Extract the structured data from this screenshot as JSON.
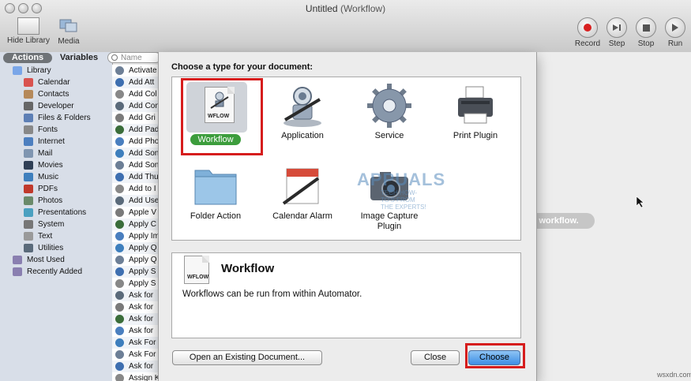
{
  "window": {
    "title": "Untitled",
    "title_suffix": "(Workflow)"
  },
  "toolbar": {
    "hide_library": "Hide Library",
    "media": "Media",
    "record": "Record",
    "step": "Step",
    "stop": "Stop",
    "run": "Run",
    "record_color": "#d82020"
  },
  "library": {
    "actions_tab": "Actions",
    "variables_tab": "Variables",
    "search_placeholder": "Name",
    "items": [
      {
        "label": "Library",
        "icon": "library-icon",
        "color": "#7aa6e8"
      },
      {
        "label": "Calendar",
        "icon": "calendar-icon",
        "color": "#d9534f"
      },
      {
        "label": "Contacts",
        "icon": "contacts-icon",
        "color": "#b5895a"
      },
      {
        "label": "Developer",
        "icon": "developer-icon",
        "color": "#666666"
      },
      {
        "label": "Files & Folders",
        "icon": "finder-icon",
        "color": "#5d7fb5"
      },
      {
        "label": "Fonts",
        "icon": "fonts-icon",
        "color": "#888888"
      },
      {
        "label": "Internet",
        "icon": "internet-icon",
        "color": "#4d7fbf"
      },
      {
        "label": "Mail",
        "icon": "mail-icon",
        "color": "#7f95b0"
      },
      {
        "label": "Movies",
        "icon": "movies-icon",
        "color": "#2f3f55"
      },
      {
        "label": "Music",
        "icon": "music-icon",
        "color": "#3e7fbd"
      },
      {
        "label": "PDFs",
        "icon": "pdf-icon",
        "color": "#c0392b"
      },
      {
        "label": "Photos",
        "icon": "photos-icon",
        "color": "#6a8a6a"
      },
      {
        "label": "Presentations",
        "icon": "presentations-icon",
        "color": "#4aa0c0"
      },
      {
        "label": "System",
        "icon": "system-icon",
        "color": "#777777"
      },
      {
        "label": "Text",
        "icon": "text-icon",
        "color": "#9a9a9a"
      },
      {
        "label": "Utilities",
        "icon": "utilities-icon",
        "color": "#5a6a7a"
      },
      {
        "label": "Most Used",
        "icon": "folder-icon",
        "color": "#8a7fb0"
      },
      {
        "label": "Recently Added",
        "icon": "folder-icon",
        "color": "#8a7fb0"
      }
    ]
  },
  "actions": [
    "Activate",
    "Add Att",
    "Add Col",
    "Add Con",
    "Add Gri",
    "Add Pad",
    "Add Pho",
    "Add Son",
    "Add Son",
    "Add Thu",
    "Add to I",
    "Add Use",
    "Apple V",
    "Apply C",
    "Apply Im",
    "Apply Q",
    "Apply Q",
    "Apply S",
    "Apply S",
    "Ask for",
    "Ask for",
    "Ask for",
    "Ask for",
    "Ask For",
    "Ask For",
    "Ask for",
    "Assign Keywords to Images"
  ],
  "dialog": {
    "prompt": "Choose a type for your document:",
    "types": [
      {
        "label": "Workflow",
        "icon": "workflow-document-icon",
        "badge": "WFLOW"
      },
      {
        "label": "Application",
        "icon": "automator-robot-icon"
      },
      {
        "label": "Service",
        "icon": "gear-icon"
      },
      {
        "label": "Print Plugin",
        "icon": "printer-icon"
      },
      {
        "label": "Folder Action",
        "icon": "folder-icon"
      },
      {
        "label": "Calendar Alarm",
        "icon": "calendar-alarm-icon"
      },
      {
        "label": "Image Capture Plugin",
        "icon": "camera-icon"
      }
    ],
    "selected_title": "Workflow",
    "selected_badge": "WFLOW",
    "selected_description": "Workflows can be run from within Automator.",
    "open_existing": "Open an Existing Document...",
    "close": "Close",
    "choose": "Choose",
    "highlight_color": "#d61d1d"
  },
  "workarea": {
    "hint": "r workflow."
  },
  "watermark": {
    "text": "APPUALS",
    "sub": "TECH HOW-TO'S FROM THE EXPERTS!"
  },
  "site": "wsxdn.com"
}
